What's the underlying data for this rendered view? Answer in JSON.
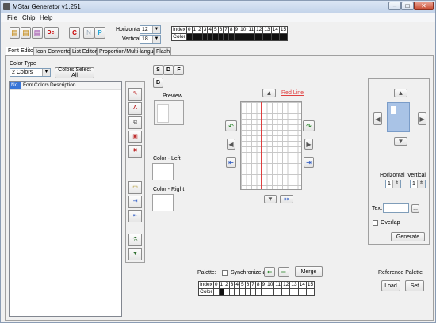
{
  "window": {
    "title": "MStar Generator v1.251"
  },
  "menu": [
    "File",
    "Chip",
    "Help"
  ],
  "toolbar": {
    "del_label": "Del",
    "c_label": "C",
    "n_label": "N",
    "p_label": "P",
    "horizontal_label": "Horizontal",
    "horizontal_value": "12",
    "vertical_label": "Vertical",
    "vertical_value": "18"
  },
  "index_table": {
    "index_label": "Index",
    "color_label": "Color",
    "indices": [
      "0",
      "1",
      "2",
      "3",
      "4",
      "5",
      "6",
      "7",
      "8",
      "9",
      "10",
      "11",
      "12",
      "13",
      "14",
      "15"
    ]
  },
  "tabs": [
    "Font Editor",
    "Icon Converter",
    "List Editor",
    "Proportion/Multi-language",
    "Flash"
  ],
  "left": {
    "color_type_label": "Color Type",
    "color_type_value": "2 Colors",
    "colors_select_all": "Colors Select All",
    "columns": [
      "No.",
      "Font",
      "Colors",
      "Description"
    ]
  },
  "mode_buttons": {
    "s": "S",
    "d": "D",
    "f": "F",
    "b": "B"
  },
  "preview_label": "Preview",
  "color_left_label": "Color - Left",
  "color_right_label": "Color - Right",
  "red_line_label": "Red Line",
  "right": {
    "horizontal_label": "Horizontal",
    "vertical_label": "Vertical",
    "horizontal_value": "1",
    "vertical_value": "1",
    "text_label": "Text",
    "browse_label": "...",
    "overlap_label": "Overlap",
    "generate_label": "Generate"
  },
  "palette": {
    "label": "Palette:",
    "sync_label": "Synchronize all",
    "merge_label": "Merge",
    "index_label": "Index",
    "color_label": "Color",
    "indices": [
      "0",
      "1",
      "2",
      "3",
      "4",
      "5",
      "6",
      "7",
      "8",
      "9",
      "10",
      "11",
      "12",
      "13",
      "14",
      "15"
    ]
  },
  "reference_palette": {
    "label": "Reference Palette",
    "load": "Load",
    "set": "Set"
  },
  "colors": {
    "accent_cyan": "#2aa8d8",
    "del_red": "#c80000",
    "select_blue": "#3875d7",
    "red_line": "#e04040",
    "preview_blue": "#a9c3e6"
  }
}
